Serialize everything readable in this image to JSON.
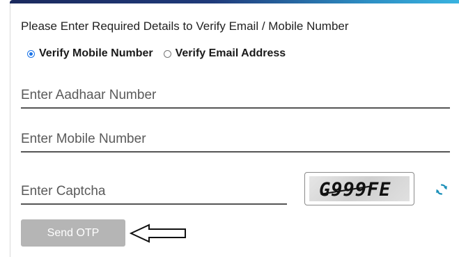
{
  "form": {
    "heading": "Please Enter Required Details to Verify Email / Mobile Number",
    "verify_options": [
      {
        "label": "Verify Mobile Number",
        "selected": true
      },
      {
        "label": "Verify Email Address",
        "selected": false
      }
    ],
    "aadhaar": {
      "placeholder": "Enter Aadhaar Number",
      "value": ""
    },
    "mobile": {
      "placeholder": "Enter Mobile Number",
      "value": ""
    },
    "captcha": {
      "placeholder": "Enter Captcha",
      "value": "",
      "image_text": "G999FE"
    },
    "send_otp_label": "Send OTP"
  },
  "colors": {
    "accent": "#1a73e8",
    "button_disabled": "#b5b5b5",
    "top_bar_start": "#1b2a5e",
    "top_bar_end": "#39b3e0"
  },
  "icons": {
    "refresh": "refresh-icon",
    "pointer": "arrow-left-icon"
  }
}
